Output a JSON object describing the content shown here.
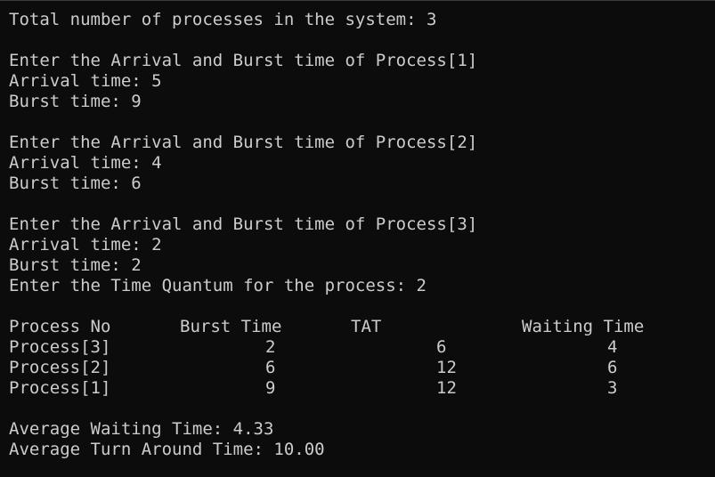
{
  "window": {
    "background": "#0c0c0c",
    "foreground": "#cccccc"
  },
  "output": {
    "total_line": "Total number of processes in the system: 3",
    "inputs": [
      {
        "prompt": "Enter the Arrival and Burst time of Process[1]",
        "arrival": "Arrival time: 5",
        "burst": "Burst time: 9"
      },
      {
        "prompt": "Enter the Arrival and Burst time of Process[2]",
        "arrival": "Arrival time: 4",
        "burst": "Burst time: 6"
      },
      {
        "prompt": "Enter the Arrival and Burst time of Process[3]",
        "arrival": "Arrival time: 2",
        "burst": "Burst time: 2"
      }
    ],
    "quantum_line": "Enter the Time Quantum for the process: 2",
    "table": {
      "headers": [
        "Process No",
        "Burst Time",
        "TAT",
        "Waiting Time"
      ],
      "rows": [
        [
          "Process[3]",
          "2",
          "6",
          "4"
        ],
        [
          "Process[2]",
          "6",
          "12",
          "6"
        ],
        [
          "Process[1]",
          "9",
          "12",
          "3"
        ]
      ]
    },
    "avg_waiting": "Average Waiting Time: 4.33",
    "avg_tat": "Average Turn Around Time: 10.00"
  }
}
